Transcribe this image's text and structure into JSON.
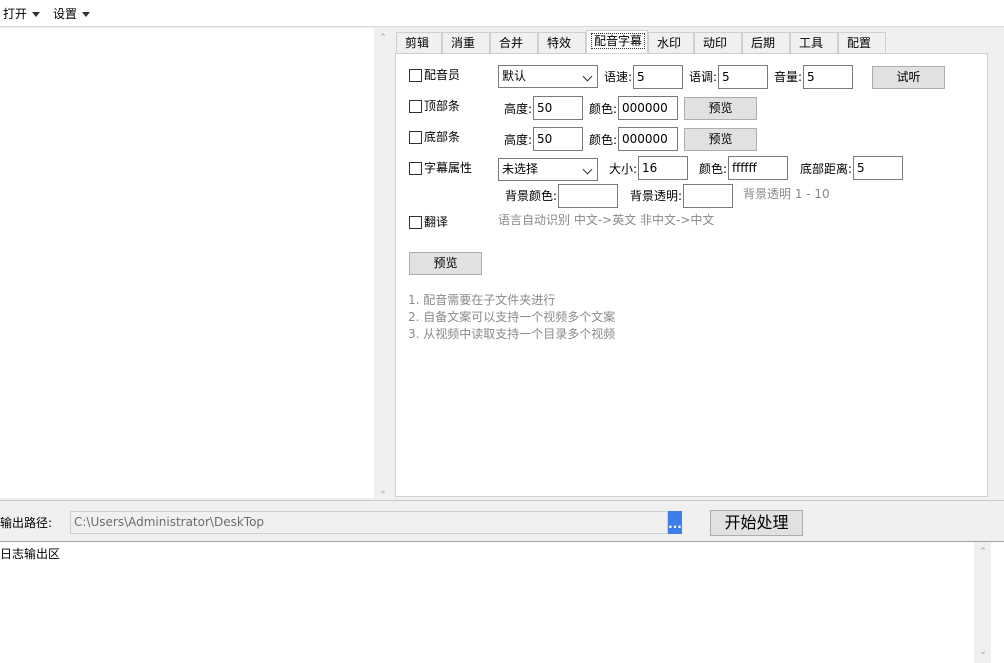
{
  "menu": {
    "open": "打开",
    "settings": "设置"
  },
  "tabs": [
    {
      "label": "剪辑"
    },
    {
      "label": "消重"
    },
    {
      "label": "合并"
    },
    {
      "label": "特效"
    },
    {
      "label": "配音字幕"
    },
    {
      "label": "水印"
    },
    {
      "label": "动印"
    },
    {
      "label": "后期"
    },
    {
      "label": "工具"
    },
    {
      "label": "配置"
    }
  ],
  "active_tab": "配音字幕",
  "voice": {
    "label": "配音员",
    "select_value": "默认",
    "speed_label": "语速:",
    "speed_value": "5",
    "pitch_label": "语调:",
    "pitch_value": "5",
    "volume_label": "音量:",
    "volume_value": "5",
    "listen_button": "试听"
  },
  "top_bar": {
    "label": "顶部条",
    "height_label": "高度:",
    "height_value": "50",
    "color_label": "颜色:",
    "color_value": "000000",
    "preview_button": "预览"
  },
  "bottom_bar": {
    "label": "底部条",
    "height_label": "高度:",
    "height_value": "50",
    "color_label": "颜色:",
    "color_value": "000000",
    "preview_button": "预览"
  },
  "subtitle": {
    "label": "字幕属性",
    "select_value": "未选择",
    "size_label": "大小:",
    "size_value": "16",
    "color_label": "颜色:",
    "color_value": "ffffff",
    "bottom_distance_label": "底部距离:",
    "bottom_distance_value": "5",
    "bg_color_label": "背景颜色:",
    "bg_color_value": "",
    "bg_opacity_label": "背景透明:",
    "bg_opacity_value": "",
    "bg_opacity_hint": "背景透明 1 - 10"
  },
  "translate": {
    "label": "翻译",
    "hint": "语言自动识别 中文->英文  非中文->中文"
  },
  "preview_button": "预览",
  "notes": [
    "1. 配音需要在子文件夹进行",
    "2. 自备文案可以支持一个视频多个文案",
    "3. 从视频中读取支持一个目录多个视频"
  ],
  "output": {
    "label": "输出路径:",
    "path": "C:\\Users\\Administrator\\DeskTop",
    "browse": "...",
    "start_button": "开始处理"
  },
  "log": {
    "label": "日志输出区"
  },
  "colors": {
    "browse_button": "#3f7de8"
  }
}
